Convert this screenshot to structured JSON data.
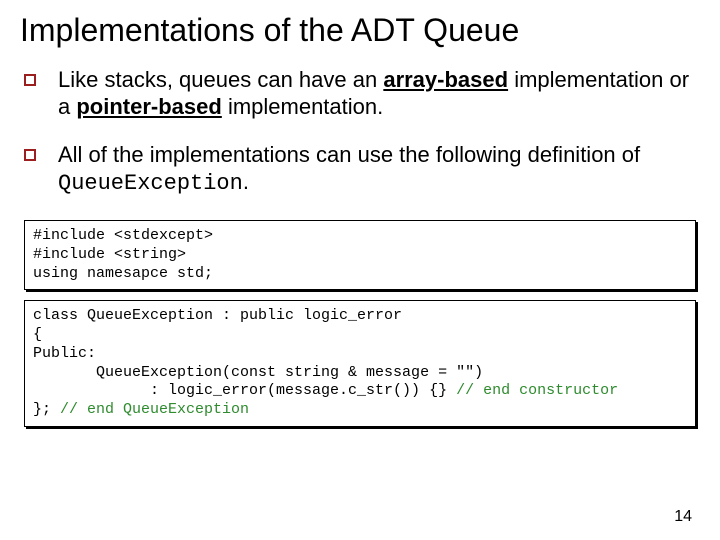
{
  "title": "Implementations of the ADT Queue",
  "bullets": [
    {
      "pre": "Like stacks, queues can have an ",
      "bold1": "array-based",
      "mid": " implementation or a ",
      "bold2": "pointer-based",
      "post": " implementation."
    },
    {
      "pre": "All of the implementations can use the following definition of ",
      "code": "QueueException",
      "post": "."
    }
  ],
  "code1": {
    "l1": "#include <stdexcept>",
    "l2": "#include <string>",
    "l3": "using namesapce std;"
  },
  "code2": {
    "l1": "class QueueException : public logic_error",
    "l2": "{",
    "l3": "Public:",
    "l4": "       QueueException(const string & message = \"\")",
    "l5a": "             : logic_error(message.c_str()) {} ",
    "l5c": "// end constructor",
    "l6a": "}; ",
    "l6c": "// end QueueException"
  },
  "slide_number": "14"
}
